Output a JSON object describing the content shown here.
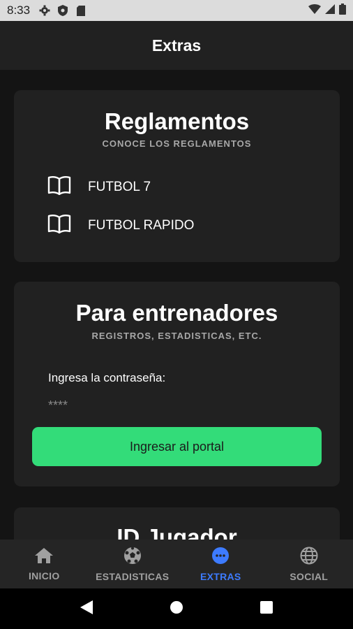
{
  "status_bar": {
    "time": "8:33"
  },
  "app_bar": {
    "title": "Extras"
  },
  "reglamentos": {
    "title": "Reglamentos",
    "subtitle": "CONOCE LOS REGLAMENTOS",
    "items": [
      {
        "label": "FUTBOL 7",
        "icon": "book-icon"
      },
      {
        "label": "FUTBOL RAPIDO",
        "icon": "book-icon"
      }
    ]
  },
  "entrenadores": {
    "title": "Para entrenadores",
    "subtitle": "REGISTROS, ESTADISTICAS, ETC.",
    "password_label": "Ingresa la contraseña:",
    "password_placeholder": "****",
    "button_label": "Ingresar al portal"
  },
  "jugador": {
    "title": "ID Jugador"
  },
  "bottom_nav": {
    "active": "EXTRAS",
    "items": [
      {
        "label": "INICIO",
        "icon": "home-icon"
      },
      {
        "label": "ESTADISTICAS",
        "icon": "soccer-ball-icon"
      },
      {
        "label": "EXTRAS",
        "icon": "more-icon"
      },
      {
        "label": "SOCIAL",
        "icon": "globe-icon"
      }
    ]
  },
  "colors": {
    "background": "#141414",
    "card": "#212121",
    "accent_green": "#33dc79",
    "active_nav": "#3d7bff",
    "inactive_nav": "#a0a0a0"
  }
}
